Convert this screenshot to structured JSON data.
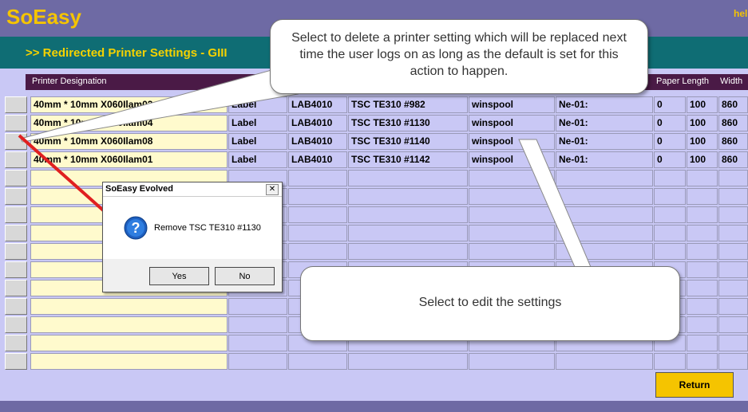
{
  "app": {
    "logo": "SoEasy",
    "help_label": "help"
  },
  "page": {
    "title": ">> Redirected Printer Settings - GIII"
  },
  "columns": [
    "Printer Designation",
    "Paper Length",
    "Width"
  ],
  "rows": [
    {
      "designation": "40mm * 10mm X060Ilam03",
      "type": "Label",
      "model": "LAB4010",
      "printer": "TSC TE310 #982",
      "driver": "winspool",
      "port": "Ne-01:",
      "v1": "0",
      "v2": "100",
      "v3": "860"
    },
    {
      "designation": "40mm * 10mm X060Ilam04",
      "type": "Label",
      "model": "LAB4010",
      "printer": "TSC TE310 #1130",
      "driver": "winspool",
      "port": "Ne-01:",
      "v1": "0",
      "v2": "100",
      "v3": "860"
    },
    {
      "designation": "40mm * 10mm X060Ilam08",
      "type": "Label",
      "model": "LAB4010",
      "printer": "TSC TE310 #1140",
      "driver": "winspool",
      "port": "Ne-01:",
      "v1": "0",
      "v2": "100",
      "v3": "860"
    },
    {
      "designation": "40mm * 10mm X060Ilam01",
      "type": "Label",
      "model": "LAB4010",
      "printer": "TSC TE310 #1142",
      "driver": "winspool",
      "port": "Ne-01:",
      "v1": "0",
      "v2": "100",
      "v3": "860"
    }
  ],
  "empty_rows": 11,
  "dialog": {
    "title": "SoEasy Evolved",
    "close_glyph": "✕",
    "message": "Remove TSC TE310 #1130",
    "yes_label": "Yes",
    "no_label": "No"
  },
  "return_label": "Return",
  "callouts": {
    "delete": "Select to delete a printer setting which will be replaced next time the user logs on as long as the default is set for this action to happen.",
    "edit": "Select to edit the settings"
  },
  "colors": {
    "topbar": "#6e6aa4",
    "titlebar": "#0f6d74",
    "accent_yellow": "#f5c400",
    "header_row": "#4a1a46",
    "grid_bg": "#c9c8f5",
    "designation_bg": "#fffacd",
    "arrow_red": "#e02020"
  }
}
